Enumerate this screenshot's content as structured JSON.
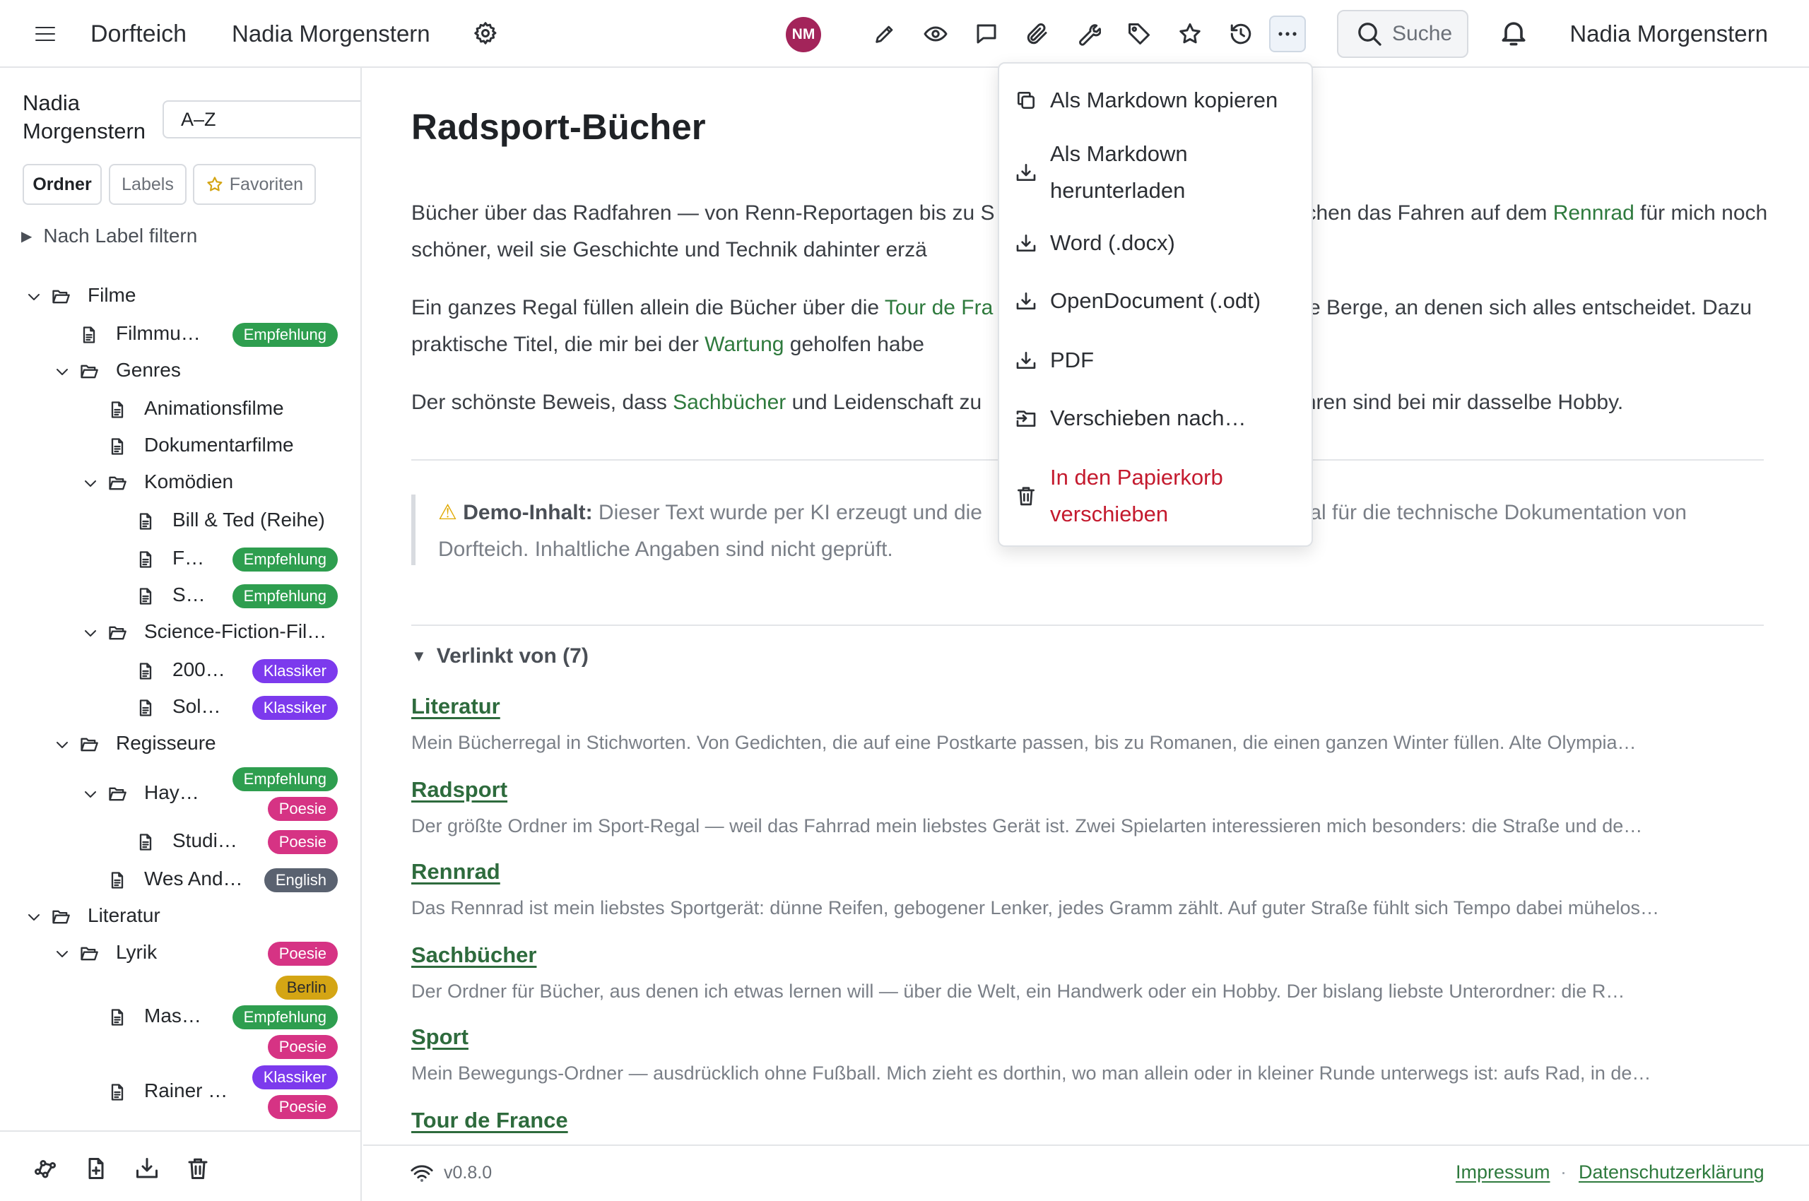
{
  "header": {
    "app_title": "Dorfteich",
    "space_title": "Nadia Morgenstern",
    "avatar_initials": "NM",
    "avatar_color": "#a3245a",
    "search_label": "Suche",
    "user_name": "Nadia Morgenstern",
    "toolbar_icons": [
      "pencil-icon",
      "eye-icon",
      "comment-icon",
      "paperclip-icon",
      "wrench-icon",
      "tag-icon",
      "star-icon",
      "history-icon",
      "more-icon"
    ]
  },
  "sidebar": {
    "owner_name": "Nadia Morgenstern",
    "sort_value": "A–Z",
    "tabs": {
      "folders": "Ordner",
      "labels": "Labels",
      "favorites": "Favoriten"
    },
    "label_filter": "Nach Label filtern"
  },
  "tree": [
    {
      "label": "Filme",
      "type": "folder",
      "expanded": true,
      "badges": []
    },
    {
      "label": "Filmmu…",
      "type": "page",
      "badges": [
        "Empfehlung"
      ]
    },
    {
      "label": "Genres",
      "type": "folder",
      "expanded": true,
      "badges": []
    },
    {
      "label": "Animationsfilme",
      "type": "page",
      "badges": []
    },
    {
      "label": "Dokumentarfilme",
      "type": "page",
      "badges": []
    },
    {
      "label": "Komödien",
      "type": "folder",
      "expanded": true,
      "badges": []
    },
    {
      "label": "Bill & Ted (Reihe)",
      "type": "page",
      "badges": []
    },
    {
      "label": "F…",
      "type": "page",
      "badges": [
        "Empfehlung"
      ]
    },
    {
      "label": "S…",
      "type": "page",
      "badges": [
        "Empfehlung"
      ]
    },
    {
      "label": "Science-Fiction-Fil…",
      "type": "folder",
      "expanded": true,
      "badges": []
    },
    {
      "label": "200…",
      "type": "page",
      "badges": [
        "Klassiker"
      ]
    },
    {
      "label": "Sol…",
      "type": "page",
      "badges": [
        "Klassiker"
      ]
    },
    {
      "label": "Regisseure",
      "type": "folder",
      "expanded": true,
      "badges": []
    },
    {
      "label": "Hay…",
      "type": "folder",
      "expanded": true,
      "badges": [
        "Empfehlung",
        "Poesie"
      ]
    },
    {
      "label": "Studi…",
      "type": "page",
      "badges": [
        "Poesie"
      ]
    },
    {
      "label": "Wes And…",
      "type": "page",
      "badges": [
        "English"
      ]
    },
    {
      "label": "Literatur",
      "type": "folder",
      "expanded": true,
      "badges": []
    },
    {
      "label": "Lyrik",
      "type": "folder",
      "expanded": true,
      "badges": [
        "Poesie"
      ]
    },
    {
      "label": "Mas…",
      "type": "page",
      "badges": [
        "Berlin",
        "Empfehlung",
        "Poesie"
      ]
    },
    {
      "label": "Rainer …",
      "type": "page",
      "badges": [
        "Klassiker",
        "Poesie"
      ]
    }
  ],
  "badge_colors": {
    "Empfehlung": "#2e9e4f",
    "Klassiker": "#7c3aed",
    "Poesie": "#d63384",
    "English": "#5a6270",
    "Berlin": "#d4a514"
  },
  "sidebar_actions": [
    "graph-icon",
    "new-page-icon",
    "import-icon",
    "trash-icon"
  ],
  "page": {
    "title": "Radsport-Bücher",
    "p1": [
      {
        "t": "Bücher über das Radfahren — von Renn-Reportagen bis zu S"
      },
      {
        "t": "chen das Fahren auf dem ",
        "gap": true
      },
      {
        "t": "Rennrad",
        "link": true
      },
      {
        "t": " für mich noch schöner, weil sie Geschichte und Technik dahinter erzä"
      }
    ],
    "p2": [
      {
        "t": "Ein ganzes Regal füllen allein die Bücher über die "
      },
      {
        "t": "Tour de Fra",
        "link": true
      },
      {
        "t": "ie Berge, an denen sich alles entscheidet.",
        "gap": true
      },
      {
        "t": " Dazu praktische Titel, die mir bei der "
      },
      {
        "t": "Wartung",
        "link": true
      },
      {
        "t": " geholfen habe"
      }
    ],
    "p3": [
      {
        "t": "Der schönste Beweis, dass "
      },
      {
        "t": "Sachbücher",
        "link": true
      },
      {
        "t": " und Leidenschaft zu"
      },
      {
        "t": "ahren sind bei mir dasselbe Hobby.",
        "gap": true
      }
    ],
    "notice_label": "Demo-Inhalt:",
    "notice_text_a": " Dieser Text wurde per KI erzeugt und die",
    "notice_text_b": "erial für die technische Dokumentation von Dorfteich. Inhaltliche Angaben sind nicht geprüft."
  },
  "backlinks": {
    "heading": "Verlinkt von (7)",
    "items": [
      {
        "title": "Literatur",
        "desc": "Mein Bücherregal in Stichworten. Von Gedichten, die auf eine Postkarte passen, bis zu Romanen, die einen ganzen Winter füllen. Alte Olympia…"
      },
      {
        "title": "Radsport",
        "desc": "Der größte Ordner im Sport-Regal — weil das Fahrrad mein liebstes Gerät ist. Zwei Spielarten interessieren mich besonders: die Straße und de…"
      },
      {
        "title": "Rennrad",
        "desc": "Das Rennrad ist mein liebstes Sportgerät: dünne Reifen, gebogener Lenker, jedes Gramm zählt. Auf guter Straße fühlt sich Tempo dabei mühelos…"
      },
      {
        "title": "Sachbücher",
        "desc": "Der Ordner für Bücher, aus denen ich etwas lernen will — über die Welt, ein Handwerk oder ein Hobby. Der bislang liebste Unterordner: die R…"
      },
      {
        "title": "Sport",
        "desc": "Mein Bewegungs-Ordner — ausdrücklich ohne Fußball. Mich zieht es dorthin, wo man allein oder in kleiner Runde unterwegs ist: aufs Rad, in de…"
      },
      {
        "title": "Tour de France",
        "desc": ""
      }
    ]
  },
  "footer": {
    "version": "v0.8.0",
    "imprint": "Impressum",
    "separator": "·",
    "privacy": "Datenschutzerklärung"
  },
  "more_menu": {
    "copy_markdown": "Als Markdown kopieren",
    "download_markdown": "Als Markdown herunterladen",
    "word": "Word (.docx)",
    "odt": "OpenDocument (.odt)",
    "pdf": "PDF",
    "move": "Verschieben nach…",
    "trash": "In den Papierkorb verschieben"
  }
}
